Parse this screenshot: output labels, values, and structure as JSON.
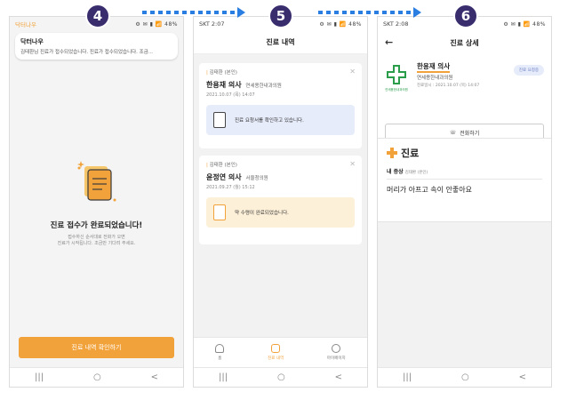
{
  "steps": {
    "s4": "4",
    "s5": "5",
    "s6": "6"
  },
  "colors": {
    "accent": "#f2a23a",
    "step_badge": "#3a2d6e",
    "arrow": "#2a7de1",
    "info_blue": "#e7ecfa",
    "info_yellow": "#fdf0d8"
  },
  "screen1": {
    "status_left": "닥터나우",
    "status_right": "⚙ ✉ ▮ 📶 48%",
    "notif_title": "닥터나우",
    "notif_msg": "김태환님 진료가 접수되었습니다. 진료가 접수되었습니다. 조금...",
    "done_title": "진료 접수가 완료되었습니다!",
    "done_sub1": "접수하신 순서대로 전화가 오면",
    "done_sub2": "진료가 시작됩니다. 조금만 기다려 주세요.",
    "button_label": "진료 내역 확인하기"
  },
  "screen2": {
    "status_left": "SKT 2:07",
    "status_right": "⚙ ✉ ▮ 📶 48%",
    "header_title": "진료 내역",
    "cards": [
      {
        "patient": "김태환 (본인)",
        "doctor": "한용재 의사",
        "hospital": "연세용한내과의원",
        "date": "2021.10.07 (목) 14:07",
        "info": "진료 요청서를 확인하고 있습니다."
      },
      {
        "patient": "김태환 (본인)",
        "doctor": "윤정연 의사",
        "hospital": "서울청의원",
        "date": "2021.09.27 (월) 15:12",
        "info": "약 수령이 완료되었습니다."
      }
    ],
    "tabs": {
      "home": "홈",
      "history": "진료 내역",
      "mypage": "마이페이지"
    }
  },
  "screen3": {
    "status_left": "SKT 2:08",
    "status_right": "⚙ ✉ ▮ 📶 48%",
    "header_title": "진료 상세",
    "doctor": "한용재 의사",
    "hospital": "연세용한내과의원",
    "date": "진료일시 : 2021.10.07 (목) 14:07",
    "badge": "진료 요청중",
    "logo_caption": "연세용한내과의원",
    "call_label": "전화하기",
    "treat_title": "진료",
    "symptom_label": "내 증상",
    "symptom_patient": "김태환 (본인)",
    "symptom_text": "머리가 아프고 속이 안좋아요"
  },
  "nav": {
    "recent": "|||",
    "home": "○",
    "back": "<"
  }
}
